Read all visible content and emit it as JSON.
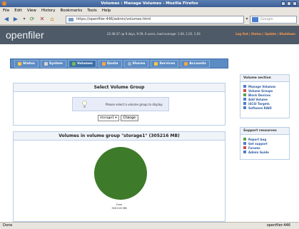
{
  "window": {
    "title": "Volumes : Manage Volumes - Mozilla Firefox"
  },
  "menu": [
    "File",
    "Edit",
    "View",
    "History",
    "Bookmarks",
    "Tools",
    "Help"
  ],
  "nav": {
    "url": "https://openfiler:446/admin/volumes.html",
    "search_placeholder": "Google"
  },
  "openfiler": {
    "logo": "openfiler",
    "status_line": "22:46:37 up 9 days, 9:39, 0 users, load average: 1.04, 1.02, 1.03",
    "top_links": "Log Out | Status | Update | Shutdown",
    "tabs": [
      {
        "label": "Status",
        "color": "#f1c84b"
      },
      {
        "label": "System",
        "color": "#d4d4d4"
      },
      {
        "label": "Volumes",
        "color": "#6fba5a"
      },
      {
        "label": "Quota",
        "color": "#f0a64a"
      },
      {
        "label": "Shares",
        "color": "#9bb5d8"
      },
      {
        "label": "Services",
        "color": "#f1c84b"
      },
      {
        "label": "Accounts",
        "color": "#f0a64a"
      }
    ]
  },
  "select_panel": {
    "heading": "Select Volume Group",
    "info_text": "Please select a volume group to display.",
    "select_value": "storage1",
    "change_button": "Change"
  },
  "volumes_panel": {
    "heading": "Volumes in volume group \"storage1\" (305216 MB)",
    "pie_label_1": "Free",
    "pie_label_2": "305216 MB",
    "pie_color": "#3d7a29"
  },
  "volume_section": {
    "heading": "Volume section",
    "items": [
      {
        "label": "Manage Volumes",
        "color": "#4a7fcf"
      },
      {
        "label": "Volume Groups",
        "color": "#c94f4f"
      },
      {
        "label": "Block Devices",
        "color": "#5d9f4a"
      },
      {
        "label": "Add Volume",
        "color": "#4a7fcf"
      },
      {
        "label": "iSCSI Targets",
        "color": "#4a7fcf"
      },
      {
        "label": "Software RAID",
        "color": "#4a7fcf"
      }
    ]
  },
  "support_resources": {
    "heading": "Support resources",
    "items": [
      {
        "label": "Report bug",
        "color": "#5d9f4a"
      },
      {
        "label": "Get support",
        "color": "#4a7fcf"
      },
      {
        "label": "Forums",
        "color": "#c94f4f"
      },
      {
        "label": "Admin Guide",
        "color": "#4a7fcf"
      }
    ]
  },
  "status": {
    "left": "Done",
    "right": "openfiler:446"
  }
}
